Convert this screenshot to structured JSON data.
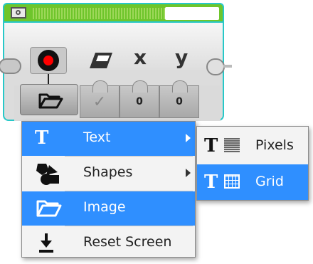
{
  "block": {
    "params": [
      {
        "header": "",
        "header_icon": "eraser-icon",
        "value_icon": "check-icon"
      },
      {
        "header": "x",
        "value": "0"
      },
      {
        "header": "y",
        "value": "0"
      }
    ],
    "mode_icon": "display-icon",
    "mode_button_icon": "folder-icon"
  },
  "menu": {
    "items": [
      {
        "label": "Text",
        "icon": "text-T-icon",
        "selected": true,
        "has_submenu": true
      },
      {
        "label": "Shapes",
        "icon": "shapes-icon",
        "selected": false,
        "has_submenu": true
      },
      {
        "label": "Image",
        "icon": "folder-icon",
        "selected": true,
        "has_submenu": false
      },
      {
        "label": "Reset Screen",
        "icon": "download-arrow-icon",
        "selected": false,
        "has_submenu": false
      }
    ]
  },
  "submenu": {
    "items": [
      {
        "label": "Pixels",
        "icon": "text-pixels-icon",
        "selected": false
      },
      {
        "label": "Grid",
        "icon": "text-grid-icon",
        "selected": true
      }
    ]
  },
  "colors": {
    "accent": "#2f8fff",
    "block_top": "#6ec52b",
    "block_outline": "#27c8c8",
    "record_dot": "#ff0000"
  }
}
